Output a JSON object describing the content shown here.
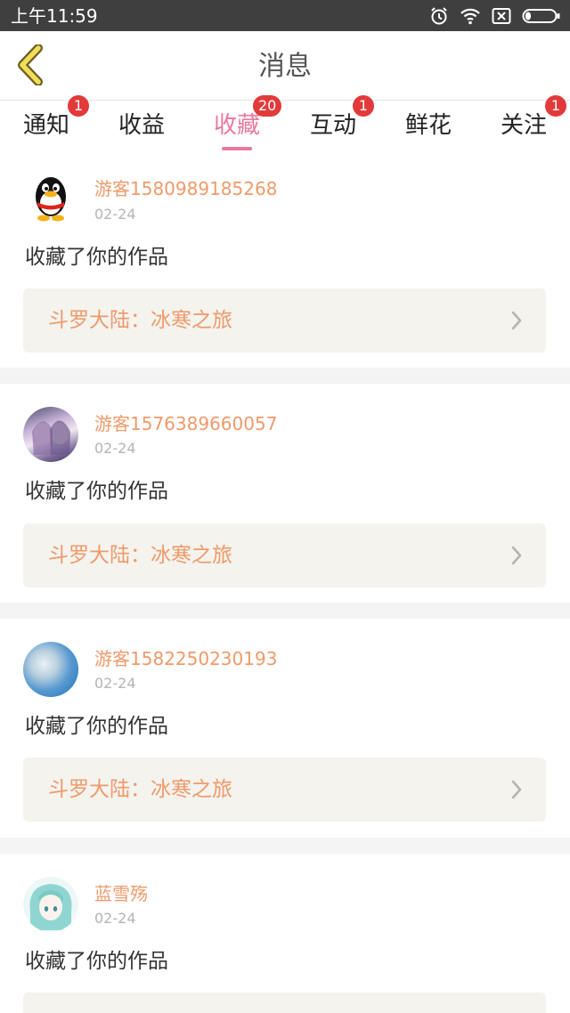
{
  "status_bar": {
    "time": "上午11:59",
    "icons": [
      "alarm-icon",
      "wifi-icon",
      "sim-blocked-icon",
      "battery-icon"
    ]
  },
  "header": {
    "back_icon": "chevron-left-icon",
    "title": "消息"
  },
  "tabs": [
    {
      "label": "通知",
      "badge": "1",
      "active": false
    },
    {
      "label": "收益",
      "badge": "",
      "active": false
    },
    {
      "label": "收藏",
      "badge": "20",
      "active": true
    },
    {
      "label": "互动",
      "badge": "1",
      "active": false
    },
    {
      "label": "鲜花",
      "badge": "",
      "active": false
    },
    {
      "label": "关注",
      "badge": "1",
      "active": false
    }
  ],
  "feed": [
    {
      "username": "游客1580989185268",
      "date": "02-24",
      "action": "收藏了你的作品",
      "work_title": "斗罗大陆：冰寒之旅",
      "avatar": "penguin-avatar"
    },
    {
      "username": "游客1576389660057",
      "date": "02-24",
      "action": "收藏了你的作品",
      "work_title": "斗罗大陆：冰寒之旅",
      "avatar": "anime-girls-avatar"
    },
    {
      "username": "游客1582250230193",
      "date": "02-24",
      "action": "收藏了你的作品",
      "work_title": "斗罗大陆：冰寒之旅",
      "avatar": "blue-photo-avatar"
    },
    {
      "username": "蓝雪殇",
      "date": "02-24",
      "action": "收藏了你的作品",
      "work_title": "",
      "avatar": "teal-anime-avatar"
    }
  ],
  "colors": {
    "accent_pink": "#e8799c",
    "username_orange": "#ef9a6a",
    "badge_red": "#e23a3a",
    "back_icon_yellow": "#f2dd5a",
    "card_bg": "#f4f3ee"
  }
}
